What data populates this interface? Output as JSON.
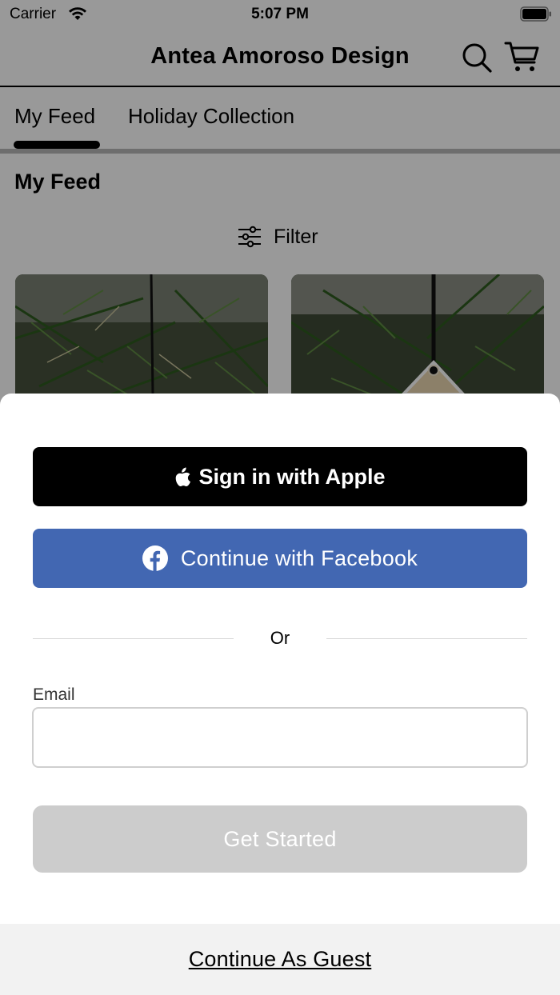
{
  "status_bar": {
    "carrier": "Carrier",
    "time": "5:07 PM",
    "icons": [
      "wifi-icon",
      "battery-icon"
    ]
  },
  "nav_bar": {
    "title": "Antea Amoroso Design",
    "icons": [
      "search-icon",
      "cart-icon"
    ]
  },
  "tabs": [
    {
      "label": "My Feed",
      "selected": true
    },
    {
      "label": "Holiday Collection",
      "selected": false
    }
  ],
  "feed": {
    "title": "My Feed",
    "filter_label": "Filter",
    "filter_icon": "sliders-icon"
  },
  "login_sheet": {
    "apple_button": "Sign in with Apple",
    "facebook_button": "Continue with Facebook",
    "divider_text": "Or",
    "email_label": "Email",
    "email_value": "",
    "email_placeholder": "",
    "get_started_button": "Get Started",
    "guest_link": "Continue As Guest"
  },
  "colors": {
    "apple_button": "#000000",
    "facebook_button": "#4267b2",
    "get_started_disabled": "#cccccc",
    "overlay": "rgba(0,0,0,0.40)",
    "guest_bar": "#f2f2f2"
  }
}
